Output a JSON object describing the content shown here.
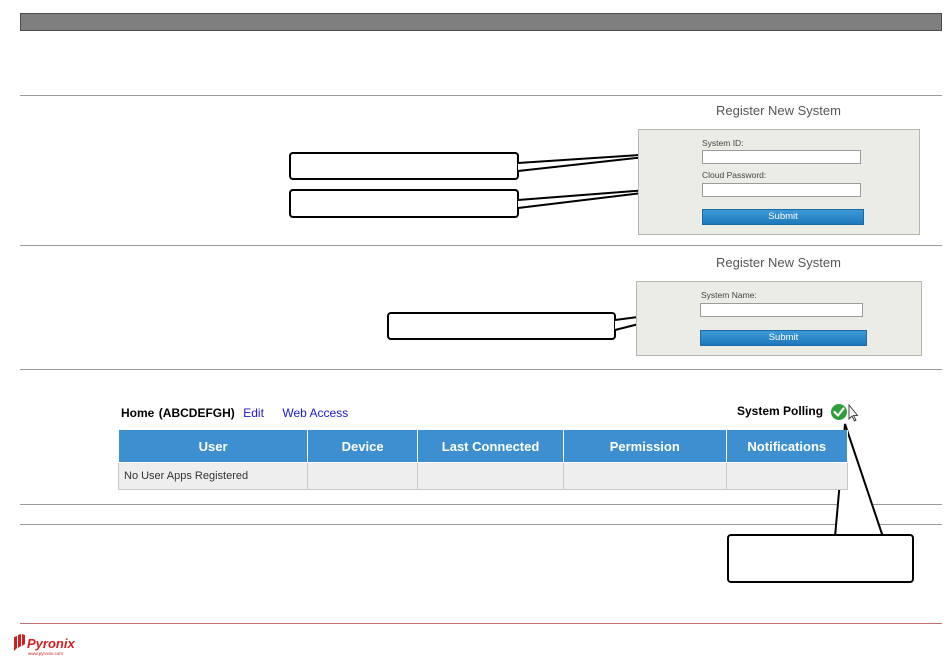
{
  "register_step1": {
    "title": "Register New System",
    "system_id_label": "System ID:",
    "system_id_value": "",
    "cloud_password_label": "Cloud Password:",
    "cloud_password_value": "",
    "submit_label": "Submit"
  },
  "register_step2": {
    "title": "Register New System",
    "system_name_label": "System Name:",
    "system_name_value": "",
    "submit_label": "Submit"
  },
  "system": {
    "home_label": "Home",
    "home_id": "(ABCDEFGH)",
    "edit_label": "Edit",
    "web_access_label": "Web Access",
    "polling_label": "System Polling",
    "polling_status_icon": "check-circle-icon",
    "polling_color": "#2e9e3a"
  },
  "users_table": {
    "columns": [
      "User",
      "Device",
      "Last Connected",
      "Permission",
      "Notifications"
    ],
    "rows": [
      [
        "No User Apps Registered",
        "",
        "",
        "",
        ""
      ]
    ],
    "header_color": "#3d8fd0"
  },
  "brand": {
    "logo_text": "Pyronix",
    "logo_sub": "www.pyronix.com",
    "color": "#d21f1f"
  }
}
